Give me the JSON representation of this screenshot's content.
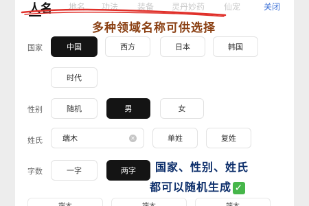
{
  "tabs": [
    {
      "label": "人名",
      "active": true
    },
    {
      "label": "地名",
      "active": false
    },
    {
      "label": "功法",
      "active": false
    },
    {
      "label": "装备",
      "active": false
    },
    {
      "label": "灵丹妙药",
      "active": false
    },
    {
      "label": "仙宠",
      "active": false
    }
  ],
  "close_label": "关闭",
  "promo": {
    "top": "多种领域名称可供选择",
    "bottom_line1": "国家、性别、姓氏",
    "bottom_line2": "都可以随机生成",
    "check_icon": "check-mark-icon",
    "check_color": "#46b64a"
  },
  "country": {
    "label": "国家",
    "options": [
      "中国",
      "西方",
      "日本",
      "韩国",
      "时代"
    ],
    "selected": "中国"
  },
  "gender": {
    "label": "性别",
    "options": [
      "随机",
      "男",
      "女"
    ],
    "selected": "男"
  },
  "surname": {
    "label": "姓氏",
    "value": "端木",
    "options": [
      "单姓",
      "复姓"
    ]
  },
  "word_count": {
    "label": "字数",
    "options": [
      "一字",
      "两字"
    ],
    "selected": "两字"
  },
  "bottom_cards": [
    "端木",
    "端木",
    "端木"
  ],
  "colors": {
    "selected_chip": "#141414",
    "close_link": "#3a6fd6",
    "top_promo": "#8a3f12",
    "bottom_promo": "#0b2d6a",
    "underline_scribble": "#e0302a"
  }
}
